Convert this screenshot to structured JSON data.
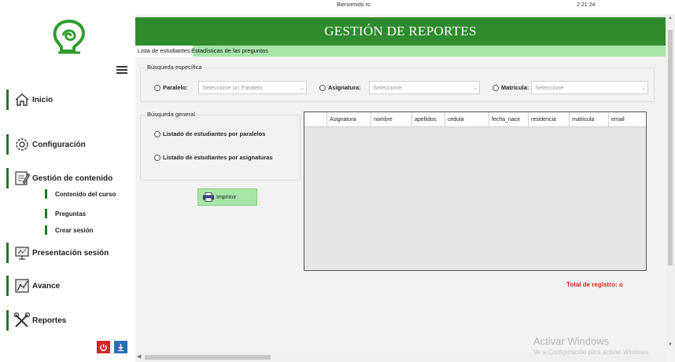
{
  "topbar": {
    "welcome": "Bienvenido ro",
    "clock": "2:21:24"
  },
  "sidebar": {
    "logo_icon": "bulb-logo-icon",
    "menu_icon": "hamburger-icon",
    "items": [
      {
        "label": "Inicio",
        "icon": "home-icon"
      },
      {
        "label": "Configuración",
        "icon": "gear-icon"
      },
      {
        "label": "Gestión de contenido",
        "icon": "edit-document-icon"
      },
      {
        "label": "Presentación sesión",
        "icon": "presentation-icon"
      },
      {
        "label": "Avance",
        "icon": "progress-icon"
      },
      {
        "label": "Reportes",
        "icon": "tools-icon"
      }
    ],
    "subitems": [
      {
        "label": "Contenido del curso"
      },
      {
        "label": "Preguntas"
      },
      {
        "label": "Crear sesión"
      }
    ],
    "power_icon": "power-icon",
    "download_icon": "download-icon",
    "colors": {
      "accent": "#1f7a1f",
      "power": "#d9252a",
      "download": "#2a6fb5"
    }
  },
  "header": {
    "title": "GESTIÓN DE REPORTES",
    "color": "#2e8b2e"
  },
  "tabs": [
    {
      "label": "Lista de estudiantes",
      "active": true
    },
    {
      "label": "Estadísticas de las preguntas",
      "active": false
    }
  ],
  "specific": {
    "legend": "Búsqueda específica",
    "paralelo": {
      "label": "Paralelo:",
      "placeholder": "Seleccione un Paralelo"
    },
    "asignatura": {
      "label": "Asignatura:",
      "placeholder": "Seleccione"
    },
    "matricula": {
      "label": "Matrícula:",
      "placeholder": "Seleccione"
    }
  },
  "general": {
    "legend": "Búsqueda general",
    "option1": "Listado de estudiantes por paralelos",
    "option2": "Listado de estudiantes por asignaturas"
  },
  "print_button": {
    "label": "Imprimir",
    "icon": "printer-icon"
  },
  "grid": {
    "columns": [
      "Asignatura",
      "nombre",
      "apellidos",
      "cedula",
      "fecha_nacir",
      "residencia",
      "matricula",
      "email"
    ],
    "rows": []
  },
  "total": "Total de registro: o",
  "watermark": {
    "line1": "Activar Windows",
    "line2": "Ve a Configuración para activar Windows."
  }
}
